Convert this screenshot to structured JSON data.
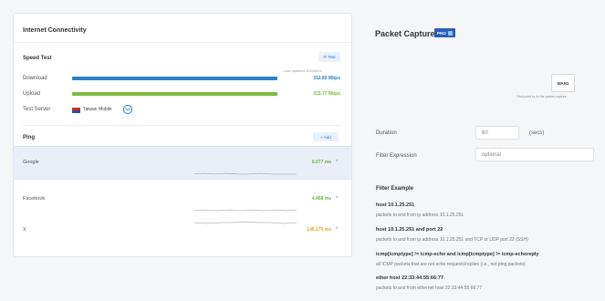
{
  "connectivity": {
    "title": "Internet Connectivity",
    "speed_test": {
      "title": "Speed Test",
      "last_tested": "Last updated 2023/6/21",
      "test_button": "⟳ Test",
      "download": {
        "label": "Download",
        "value": "312.82 Mbps",
        "fraction": 0.97,
        "color": "#2a7fc9"
      },
      "upload": {
        "label": "Upload",
        "value": "315.77 Mbps",
        "fraction": 0.97,
        "color": "#7dbd3a"
      },
      "server": {
        "label": "Test Server",
        "name": "Taiwan Mobile"
      }
    },
    "ping": {
      "title": "Ping",
      "add_button": "+ Add",
      "targets": [
        {
          "name": "Google",
          "value": "0.077 ms",
          "color": "#6db33f",
          "selected": true
        },
        {
          "name": "Facebook",
          "value": "4.458 ms",
          "color": "#6db33f",
          "selected": false
        },
        {
          "name": "X",
          "value": "145.175 ms",
          "color": "#f0a020",
          "selected": false
        }
      ]
    }
  },
  "packet_capture": {
    "title": "Packet Capture",
    "badge": "PRO",
    "interface": "WAN1",
    "interface_hint": "Click point to do the packet capture",
    "duration": {
      "label": "Duration",
      "value": "60",
      "unit": "(secs)"
    },
    "filter": {
      "label": "Filter Expression",
      "placeholder": "optional"
    },
    "examples_title": "Filter Example",
    "examples": [
      {
        "cmd": "host 10.1.25.251",
        "desc": "packets to and from ip address 10.1.25.251"
      },
      {
        "cmd": "host 10.1.25.251 and port 22",
        "desc": "packets to and from ip address 10.1.25.251 and TCP or UDP port 22 (SSH)"
      },
      {
        "cmd": "icmp[icmptype] != icmp-echo and icmp[icmptype] != icmp-echoreply",
        "desc": "all ICMP packets that are not echo requests/replies (i.e., not ping packets)"
      },
      {
        "cmd": "ether host 22:33:44:55:66:77",
        "desc": "packets to and from ethernet host 22:33:44:55:66:77"
      }
    ]
  }
}
